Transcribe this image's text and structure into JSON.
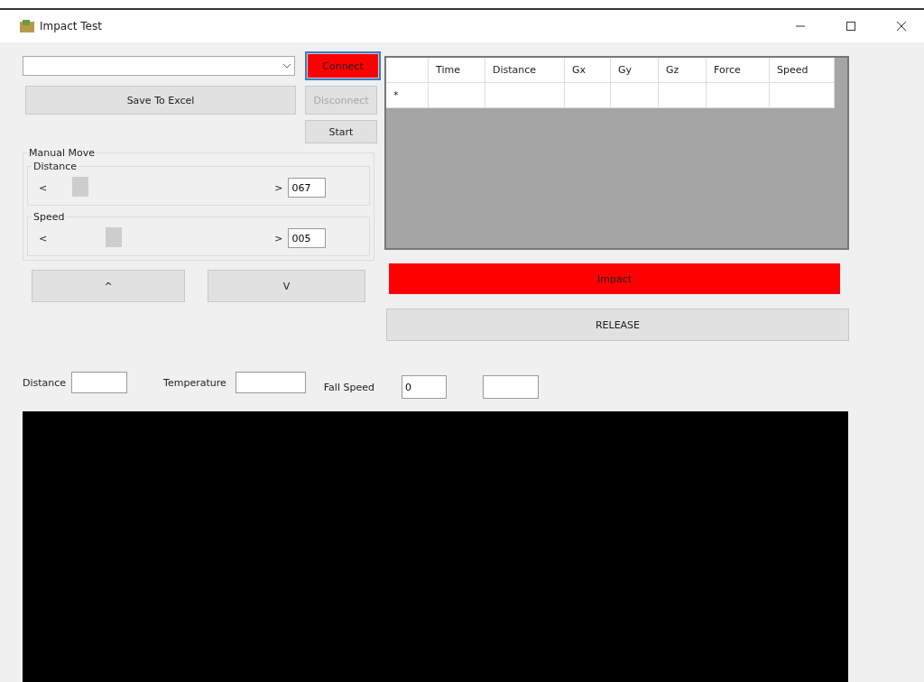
{
  "window": {
    "title": "Impact Test"
  },
  "buttons": {
    "connect": {
      "label": "Connect",
      "disabled": false
    },
    "save": {
      "label": "Save To Excel"
    },
    "disconnect": {
      "label": "Disconnect",
      "disabled": true
    },
    "start": {
      "label": "Start"
    }
  },
  "manual_move": {
    "title": "Manual Move",
    "sliders": [
      {
        "title": "Distance",
        "left": "<",
        "right": ">",
        "value": "067"
      },
      {
        "title": "Speed",
        "left": "<",
        "right": ">",
        "value": "005"
      }
    ],
    "jog_buttons": [
      "^",
      "V"
    ]
  },
  "table": {
    "columns": [
      "Time",
      "Distance",
      "Gx",
      "Gy",
      "Gz",
      "Force",
      "Speed"
    ],
    "new_row_marker": "*"
  },
  "impact_button": {
    "label": "Impact"
  },
  "release_button": {
    "label": "RELEASE"
  },
  "readouts": [
    {
      "label": "Distance"
    },
    {
      "label": "Temperature"
    },
    {
      "label": "Fall Speed",
      "value": "0"
    }
  ]
}
